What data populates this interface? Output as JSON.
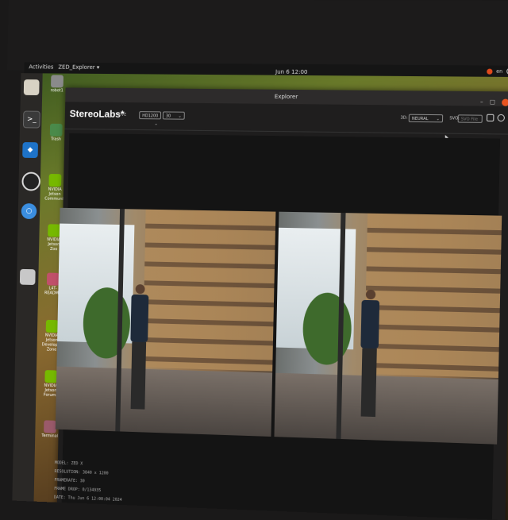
{
  "topbar": {
    "activities": "Activities",
    "app_menu": "ZED_Explorer ▾",
    "clock": "Jun 6 12:00",
    "keyboard": "en"
  },
  "desktop": {
    "items": [
      "robot1",
      "Trash",
      "NVIDIA Jetson Community",
      "NVIDIA Jetson Zoo",
      "L4T-README",
      "NVIDIA Jetson Developer Zone",
      "NVIDIA Jetson Forums",
      "Terminal"
    ]
  },
  "window": {
    "title": "Explorer"
  },
  "toolbar": {
    "brand": "StereoLabs*",
    "live": "LIVE",
    "resolution_value": "HD1200",
    "fps_value": "30",
    "depth_label": "3D:",
    "depth_value": "NEURAL",
    "svo_label": "SVO:",
    "svo_placeholder": "SVO File"
  },
  "info": {
    "model": "MODEL: ZED X",
    "resolution": "RESOLUTION: 3840 x 1200",
    "framerate": "FRAMERATE: 30",
    "frame_drop": "FRAME DROP: 0/134935",
    "date": "DATE: Thu Jun 6 12:00:04 2024"
  }
}
